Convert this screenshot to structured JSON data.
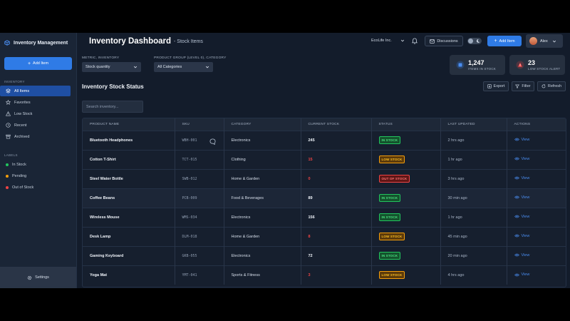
{
  "colors": {
    "accent": "#2f7be6",
    "in_stock": "#22c55e",
    "low_stock": "#f59e0b",
    "out_of_stock": "#ef4444"
  },
  "sidebar": {
    "brand": "Inventory Management",
    "add_button": "Add Item",
    "inventory_heading": "Inventory",
    "items": [
      {
        "label": "All Items",
        "icon": "layers-icon"
      },
      {
        "label": "Favorites",
        "icon": "star-icon"
      },
      {
        "label": "Low Stock",
        "icon": "warning-icon"
      },
      {
        "label": "Recent",
        "icon": "clock-icon"
      },
      {
        "label": "Archived",
        "icon": "archive-icon"
      }
    ],
    "labels_heading": "Labels",
    "labels": [
      {
        "label": "In Stock",
        "color": "#22c55e"
      },
      {
        "label": "Pending",
        "color": "#f59e0b"
      },
      {
        "label": "Out of Stock",
        "color": "#ef4444"
      }
    ],
    "settings": "Settings"
  },
  "header": {
    "title": "Inventory Dashboard",
    "subtitle": "- Stock Items",
    "company": "EcoLife Inc.",
    "discussions": "Discussions",
    "add_button": "Add Item",
    "user": "Alex"
  },
  "filters": {
    "metric_label": "Metric, Inventory",
    "metric_value": "Stock quantity",
    "group_label": "Product Group (Level 0), Category",
    "group_value": "All Categories"
  },
  "stats": {
    "items_value": "1,247",
    "items_label": "Items in Stock",
    "alert_value": "23",
    "alert_label": "Low Stock Alert"
  },
  "section": {
    "title": "Inventory Stock Status",
    "export": "Export",
    "filter": "Filter",
    "refresh": "Refresh",
    "search_placeholder": "Search inventory..."
  },
  "table": {
    "columns": [
      "Product Name",
      "SKU",
      "Category",
      "Current Stock",
      "Status",
      "Last Updated",
      "Actions"
    ],
    "action_label": "View",
    "rows": [
      {
        "name": "Bluetooth Headphones",
        "sku": "WBH-001",
        "category": "Electronics",
        "stock": "245",
        "status": "IN STOCK",
        "updated": "2 hrs ago"
      },
      {
        "name": "Cotton T-Shirt",
        "sku": "TCT-015",
        "category": "Clothing",
        "stock": "15",
        "status": "LOW STOCK",
        "updated": "1 hr ago"
      },
      {
        "name": "Steel Water Bottle",
        "sku": "SWB-012",
        "category": "Home & Garden",
        "stock": "0",
        "status": "OUT OF STOCK",
        "updated": "3 hrs ago"
      },
      {
        "name": "Coffee Beans",
        "sku": "PCB-009",
        "category": "Food & Beverages",
        "stock": "89",
        "status": "IN STOCK",
        "updated": "30 min ago"
      },
      {
        "name": "Wireless Mouse",
        "sku": "WMS-034",
        "category": "Electronics",
        "stock": "156",
        "status": "IN STOCK",
        "updated": "1 hr ago"
      },
      {
        "name": "Desk Lamp",
        "sku": "DLM-018",
        "category": "Home & Garden",
        "stock": "8",
        "status": "LOW STOCK",
        "updated": "45 min ago"
      },
      {
        "name": "Gaming Keyboard",
        "sku": "GKB-055",
        "category": "Electronics",
        "stock": "72",
        "status": "IN STOCK",
        "updated": "20 min ago"
      },
      {
        "name": "Yoga Mat",
        "sku": "YMT-041",
        "category": "Sports & Fitness",
        "stock": "3",
        "status": "LOW STOCK",
        "updated": "4 hrs ago"
      }
    ]
  }
}
